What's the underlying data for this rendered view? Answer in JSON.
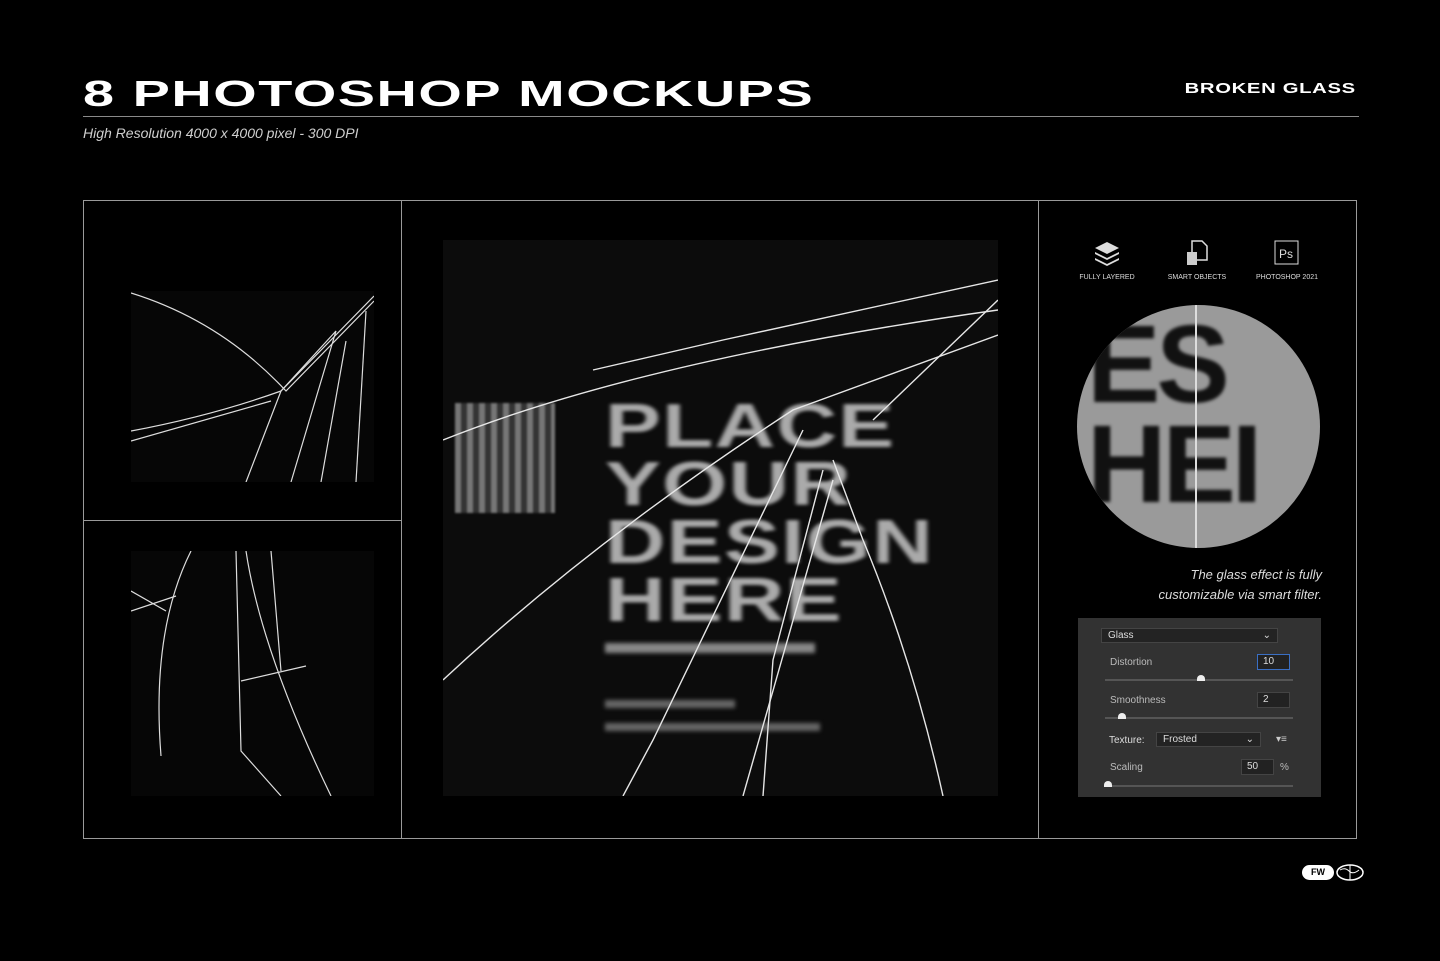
{
  "header": {
    "title": "8 PHOTOSHOP MOCKUPS",
    "brand": "BROKEN GLASS",
    "subtitle": "High Resolution 4000 x 4000 pixel - 300 DPI"
  },
  "poster": {
    "lines": [
      "PLACE",
      "YOUR",
      "DESIGN",
      "HERE"
    ]
  },
  "features": [
    {
      "label": "FULLY LAYERED",
      "icon": "layers-icon"
    },
    {
      "label": "SMART OBJECTS",
      "icon": "smart-object-icon"
    },
    {
      "label": "PHOTOSHOP 2021",
      "icon": "photoshop-icon",
      "glyph": "Ps"
    }
  ],
  "caption": [
    "The glass effect is fully",
    "customizable via smart filter."
  ],
  "filter_panel": {
    "filter": "Glass",
    "distortion": {
      "label": "Distortion",
      "value": "10",
      "fraction": 0.5
    },
    "smoothness": {
      "label": "Smoothness",
      "value": "2",
      "fraction": 0.07
    },
    "texture_label": "Texture:",
    "texture": "Frosted",
    "scaling": {
      "label": "Scaling",
      "value": "50",
      "unit": "%",
      "fraction": 0
    }
  },
  "logo": {
    "text": "FW"
  }
}
